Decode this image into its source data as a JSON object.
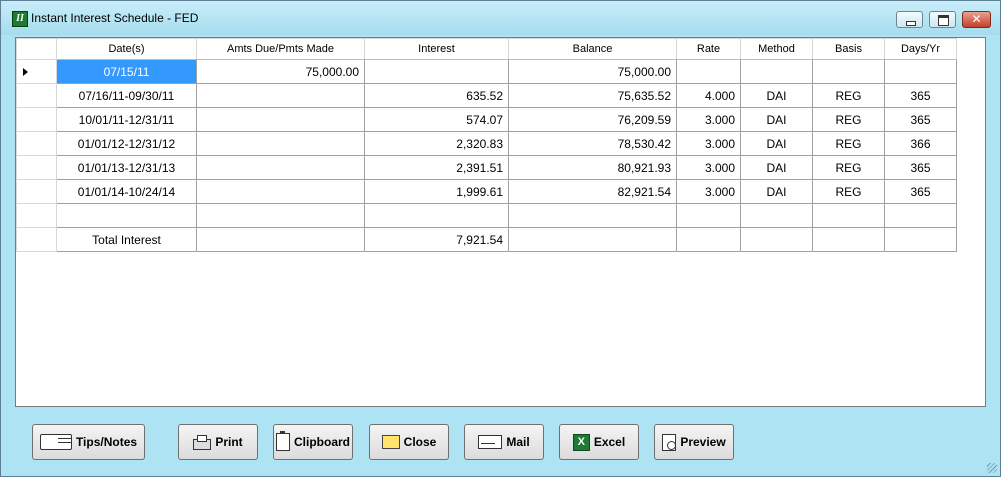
{
  "window": {
    "title": "Instant Interest Schedule - FED",
    "controls": {
      "minimize": "minimize",
      "maximize": "maximize",
      "close": "✕"
    },
    "app_icon_letter": "II"
  },
  "grid": {
    "columns": [
      "Date(s)",
      "Amts Due/Pmts Made",
      "Interest",
      "Balance",
      "Rate",
      "Method",
      "Basis",
      "Days/Yr"
    ],
    "rows": [
      {
        "date": "07/15/11",
        "amount": "75,000.00",
        "interest": "",
        "balance": "75,000.00",
        "rate": "",
        "method": "",
        "basis": "",
        "days": ""
      },
      {
        "date": "07/16/11-09/30/11",
        "amount": "",
        "interest": "635.52",
        "balance": "75,635.52",
        "rate": "4.000",
        "method": "DAI",
        "basis": "REG",
        "days": "365"
      },
      {
        "date": "10/01/11-12/31/11",
        "amount": "",
        "interest": "574.07",
        "balance": "76,209.59",
        "rate": "3.000",
        "method": "DAI",
        "basis": "REG",
        "days": "365"
      },
      {
        "date": "01/01/12-12/31/12",
        "amount": "",
        "interest": "2,320.83",
        "balance": "78,530.42",
        "rate": "3.000",
        "method": "DAI",
        "basis": "REG",
        "days": "366"
      },
      {
        "date": "01/01/13-12/31/13",
        "amount": "",
        "interest": "2,391.51",
        "balance": "80,921.93",
        "rate": "3.000",
        "method": "DAI",
        "basis": "REG",
        "days": "365"
      },
      {
        "date": "01/01/14-10/24/14",
        "amount": "",
        "interest": "1,999.61",
        "balance": "82,921.54",
        "rate": "3.000",
        "method": "DAI",
        "basis": "REG",
        "days": "365"
      },
      {
        "date": "",
        "amount": "",
        "interest": "",
        "balance": "",
        "rate": "",
        "method": "",
        "basis": "",
        "days": ""
      },
      {
        "date": "Total Interest",
        "amount": "",
        "interest": "7,921.54",
        "balance": "",
        "rate": "",
        "method": "",
        "basis": "",
        "days": ""
      }
    ]
  },
  "buttons": {
    "tips": "Tips/Notes",
    "print": "Print",
    "clipboard": "Clipboard",
    "close": "Close",
    "mail": "Mail",
    "excel": "Excel",
    "preview": "Preview"
  },
  "icons": {
    "excel_letter": "X"
  }
}
